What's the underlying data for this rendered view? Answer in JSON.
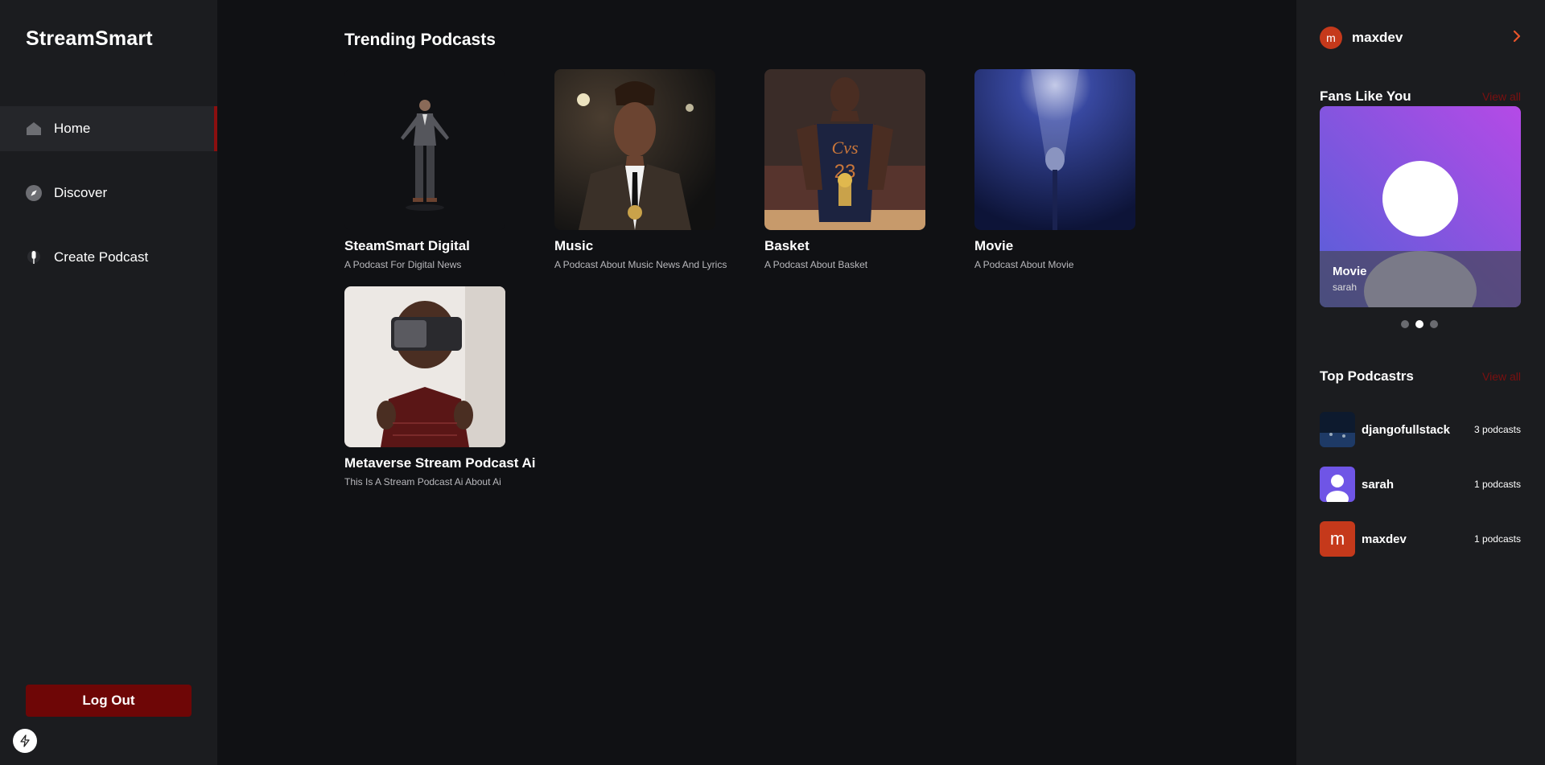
{
  "brand": "StreamSmart",
  "nav": {
    "home": "Home",
    "discover": "Discover",
    "create": "Create Podcast"
  },
  "logout_label": "Log Out",
  "main": {
    "title": "Trending Podcasts",
    "cards": [
      {
        "title": "SteamSmart Digital",
        "desc": "A Podcast For Digital News"
      },
      {
        "title": "Music",
        "desc": "A Podcast About Music News And Lyrics"
      },
      {
        "title": "Basket",
        "desc": "A Podcast About Basket"
      },
      {
        "title": "Movie",
        "desc": "A Podcast About Movie"
      },
      {
        "title": "Metaverse Stream Podcast Ai",
        "desc": "This Is A Stream Podcast Ai About Ai"
      }
    ]
  },
  "right": {
    "user": {
      "initial": "m",
      "name": "maxdev"
    },
    "fans": {
      "title": "Fans Like You",
      "view_all": "View all",
      "card_title": "Movie",
      "card_sub": "sarah",
      "active_dot": 2
    },
    "top": {
      "title": "Top Podcastrs",
      "view_all": "View all",
      "items": [
        {
          "name": "djangofullstack",
          "count": "3 podcasts"
        },
        {
          "name": "sarah",
          "count": "1 podcasts"
        },
        {
          "name": "maxdev",
          "count": "1 podcasts",
          "initial": "m"
        }
      ]
    }
  },
  "colors": {
    "accent": "#6e0606",
    "background": "#101114",
    "panel": "#1b1c1f",
    "avatar_orange": "#c5391b"
  }
}
